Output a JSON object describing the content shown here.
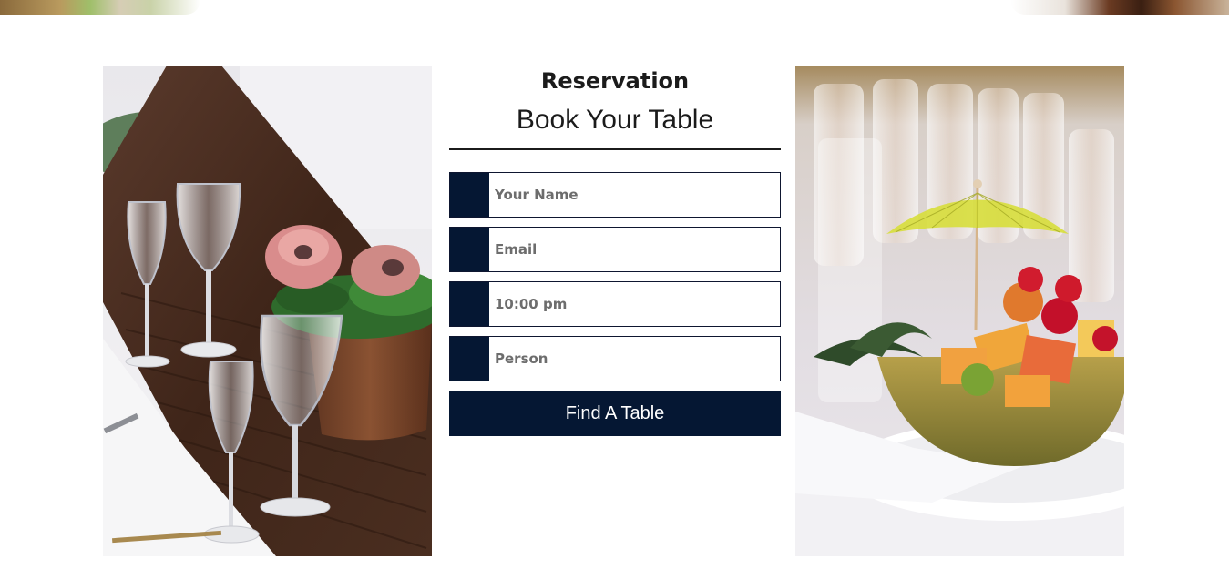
{
  "colors": {
    "accent": "#051733",
    "text_dark": "#1b1b1b",
    "placeholder": "#6d6d6d",
    "background": "#ffffff"
  },
  "reservation": {
    "kicker": "Reservation",
    "title": "Book Your Table",
    "fields": [
      {
        "placeholder": "Your Name",
        "icon": "user-icon"
      },
      {
        "placeholder": "Email",
        "icon": "email-icon"
      },
      {
        "placeholder": "10:00 pm",
        "icon": "clock-icon"
      },
      {
        "placeholder": "Person",
        "icon": "people-icon"
      }
    ],
    "submit_label": "Find A Table"
  }
}
